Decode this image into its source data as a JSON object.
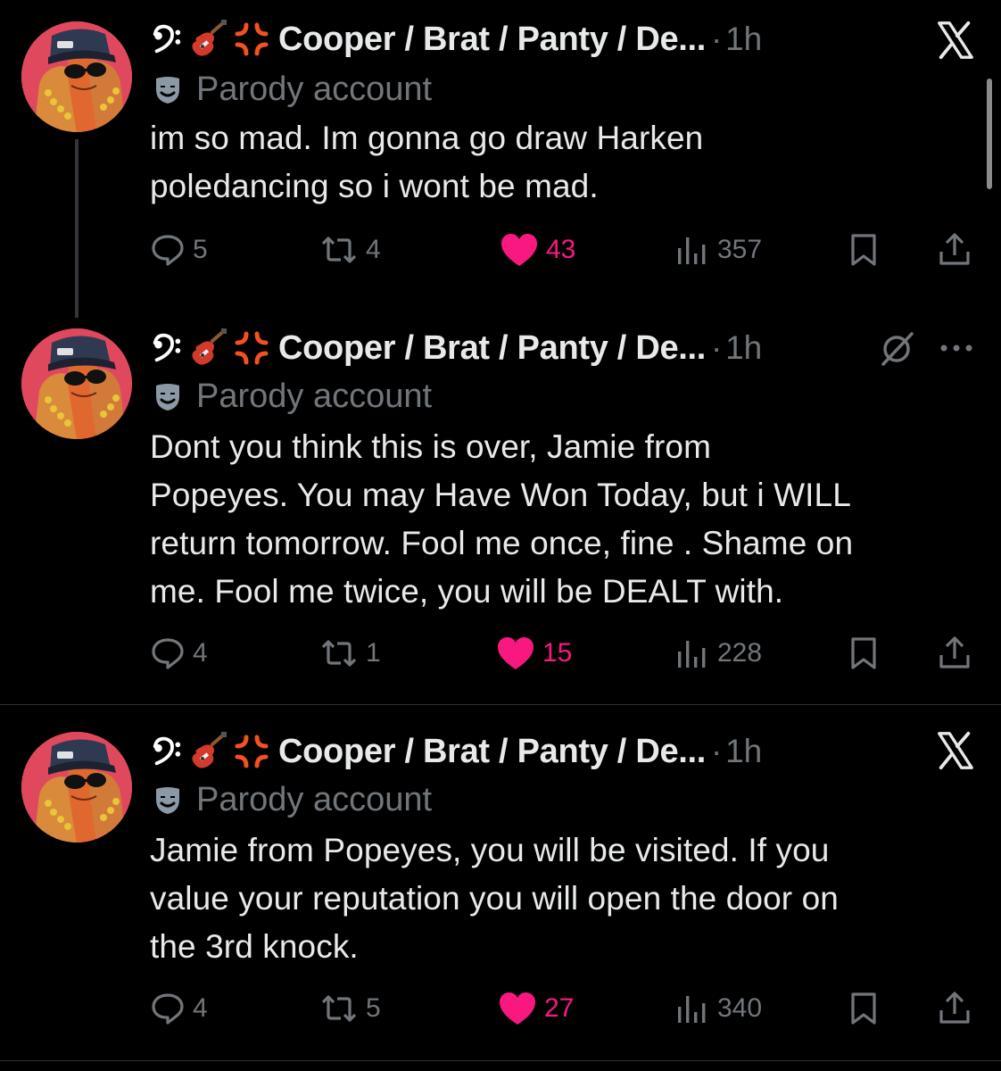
{
  "tweets": [
    {
      "display_name": "Cooper / Brat / Panty / De...",
      "separator": "·",
      "time": "1h",
      "label": "Parody account",
      "text": "im so mad. Im gonna go draw Harken\npoledancing so i wont be mad.",
      "replies": "5",
      "reposts": "4",
      "likes": "43",
      "views": "357",
      "top_right_icons": [
        "x-logo-icon"
      ]
    },
    {
      "display_name": "Cooper / Brat / Panty / De...",
      "separator": "·",
      "time": "1h",
      "label": "Parody account",
      "text": "Dont you think this is over, Jamie from\nPopeyes. You may Have Won Today, but i WILL\nreturn tomorrow. Fool me once, fine . Shame on\nme. Fool me twice, you will be DEALT with.",
      "replies": "4",
      "reposts": "1",
      "likes": "15",
      "views": "228",
      "top_right_icons": [
        "grok-icon",
        "more-icon"
      ]
    },
    {
      "display_name": "Cooper / Brat / Panty / De...",
      "separator": "·",
      "time": "1h",
      "label": "Parody account",
      "text": "Jamie from Popeyes, you will be visited. If you\nvalue your reputation you will open the door on\nthe 3rd knock.",
      "replies": "4",
      "reposts": "5",
      "likes": "27",
      "views": "340",
      "top_right_icons": [
        "x-logo-icon"
      ]
    }
  ],
  "name_emoji_icons": [
    "bass-clef-icon",
    "guitar-icon",
    "anger-icon"
  ],
  "colors": {
    "background": "#000000",
    "text": "#e7e9ea",
    "muted": "#71767b",
    "like": "#f91880",
    "avatar_bg": "#e0485e",
    "divider": "#2f3336"
  }
}
